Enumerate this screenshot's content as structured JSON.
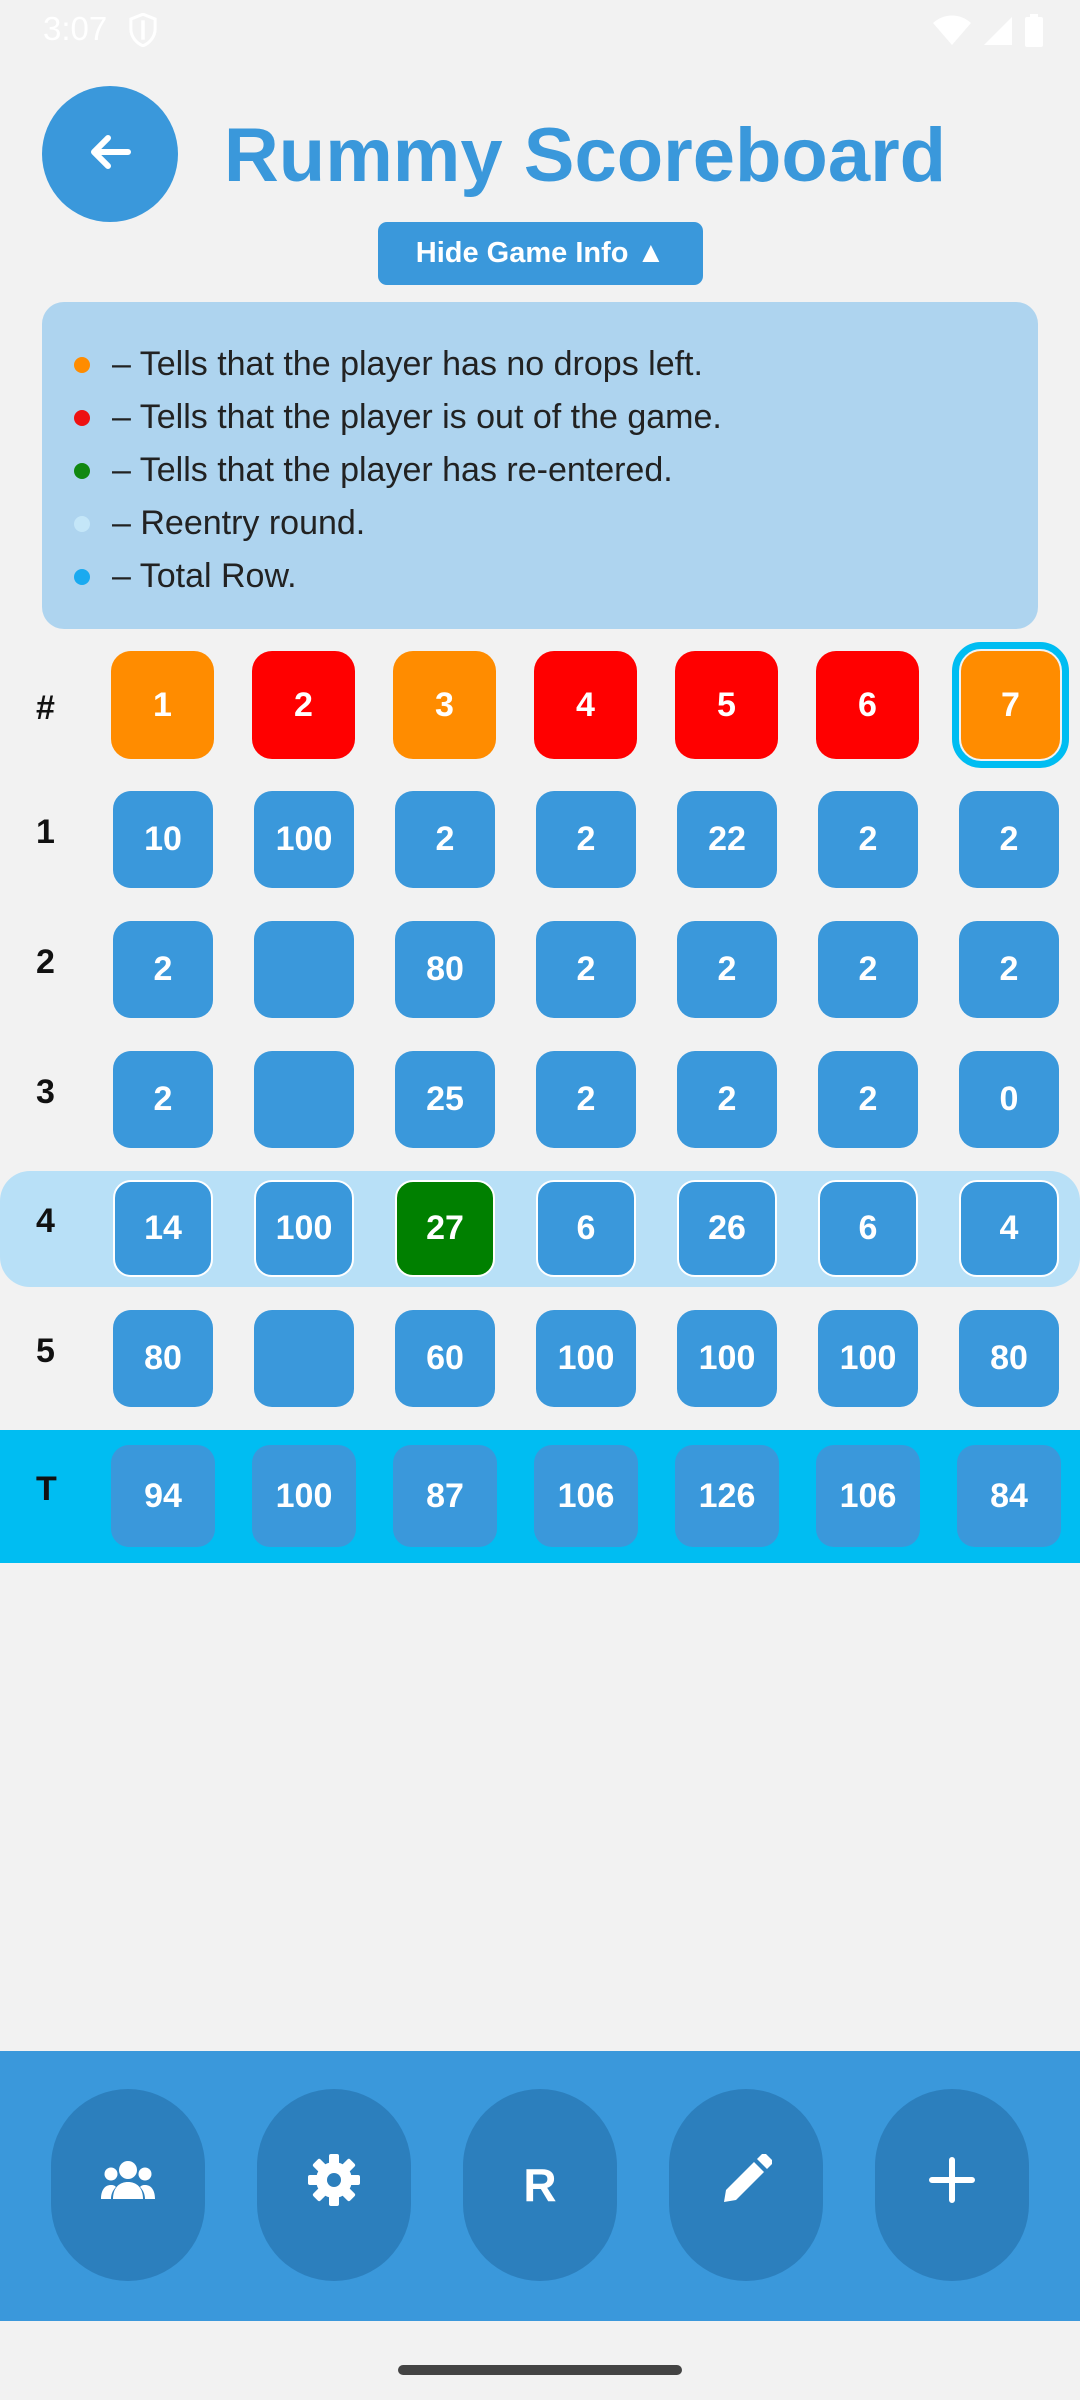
{
  "status_bar": {
    "time": "3:07"
  },
  "header": {
    "title": "Rummy Scoreboard",
    "toggle_info_label": "Hide Game Info ▲"
  },
  "legend": [
    {
      "color": "#ff8c00",
      "text": "– Tells that the player has no drops left."
    },
    {
      "color": "#ee1111",
      "text": "– Tells that the player is out of the game."
    },
    {
      "color": "#118811",
      "text": "– Tells that the player has re-entered."
    },
    {
      "color": "#c4e6f8",
      "text": "– Reentry round."
    },
    {
      "color": "#1aaaf0",
      "text": "– Total Row."
    }
  ],
  "grid": {
    "header_label": "#",
    "players": [
      {
        "label": "1",
        "status": "no-drops",
        "color": "#ff8c00"
      },
      {
        "label": "2",
        "status": "out",
        "color": "#ff0000"
      },
      {
        "label": "3",
        "status": "no-drops",
        "color": "#ff8c00"
      },
      {
        "label": "4",
        "status": "out",
        "color": "#ff0000"
      },
      {
        "label": "5",
        "status": "out",
        "color": "#ff0000"
      },
      {
        "label": "6",
        "status": "out",
        "color": "#ff0000"
      },
      {
        "label": "7",
        "status": "no-drops",
        "color": "#ff8c00",
        "selected": true
      }
    ],
    "rounds": [
      {
        "label": "1",
        "scores": [
          "10",
          "100",
          "2",
          "2",
          "22",
          "2",
          "2"
        ]
      },
      {
        "label": "2",
        "scores": [
          "2",
          "",
          "80",
          "2",
          "2",
          "2",
          "2"
        ]
      },
      {
        "label": "3",
        "scores": [
          "2",
          "",
          "25",
          "2",
          "2",
          "2",
          "0"
        ]
      },
      {
        "label": "4",
        "reentry": true,
        "scores": [
          "14",
          "100",
          "27",
          "6",
          "26",
          "6",
          "4"
        ],
        "reentered_player_index": 2
      },
      {
        "label": "5",
        "scores": [
          "80",
          "",
          "60",
          "100",
          "100",
          "100",
          "80"
        ]
      }
    ],
    "total": {
      "label": "T",
      "scores": [
        "94",
        "100",
        "87",
        "106",
        "126",
        "106",
        "84"
      ]
    }
  },
  "colors": {
    "accent": "#3a98db",
    "reentered": "#008000",
    "total_row": "#00bdf2",
    "reentry_row": "#b8e0f7"
  },
  "bottom_bar": {
    "buttons": [
      {
        "name": "players-button",
        "icon": "group-icon"
      },
      {
        "name": "settings-button",
        "icon": "gear-icon"
      },
      {
        "name": "reentry-button",
        "label": "R"
      },
      {
        "name": "edit-button",
        "icon": "pencil-icon"
      },
      {
        "name": "add-button",
        "icon": "plus-icon"
      }
    ]
  }
}
